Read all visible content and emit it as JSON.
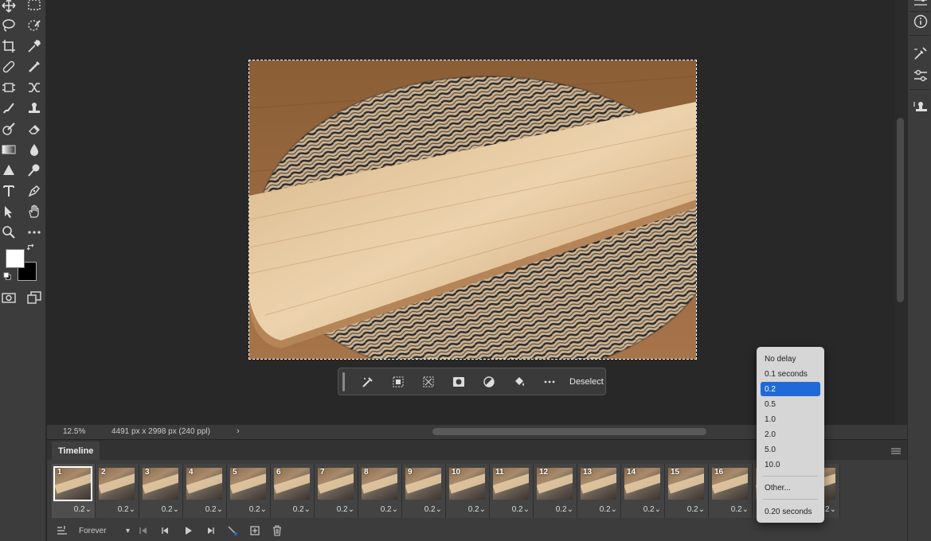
{
  "statusbar": {
    "zoom": "12.5%",
    "doc_info": "4491 px x 2998 px (240 ppl)",
    "arrow": "›"
  },
  "taskbar": {
    "deselect_label": "Deselect"
  },
  "timeline": {
    "tab_label": "Timeline",
    "loop_option": "Forever",
    "frames": [
      {
        "num": "1",
        "delay": "0.2"
      },
      {
        "num": "2",
        "delay": "0.2"
      },
      {
        "num": "3",
        "delay": "0.2"
      },
      {
        "num": "4",
        "delay": "0.2"
      },
      {
        "num": "5",
        "delay": "0.2"
      },
      {
        "num": "6",
        "delay": "0.2"
      },
      {
        "num": "7",
        "delay": "0.2"
      },
      {
        "num": "8",
        "delay": "0.2"
      },
      {
        "num": "9",
        "delay": "0.2"
      },
      {
        "num": "10",
        "delay": "0.2"
      },
      {
        "num": "11",
        "delay": "0.2"
      },
      {
        "num": "12",
        "delay": "0.2"
      },
      {
        "num": "13",
        "delay": "0.2"
      },
      {
        "num": "14",
        "delay": "0.2"
      },
      {
        "num": "15",
        "delay": "0.2"
      },
      {
        "num": "16",
        "delay": "0.2"
      },
      {
        "num": "",
        "delay": ""
      },
      {
        "num": "",
        "delay": "0.2"
      }
    ]
  },
  "delay_menu": {
    "items": [
      "No delay",
      "0.1 seconds",
      "0.2",
      "0.5",
      "1.0",
      "2.0",
      "5.0",
      "10.0"
    ],
    "selected": "0.2",
    "other": "Other...",
    "current": "0.20 seconds"
  },
  "colors": {
    "accent": "#1f6ad8",
    "foreground": "#ffffff",
    "background": "#000000"
  }
}
